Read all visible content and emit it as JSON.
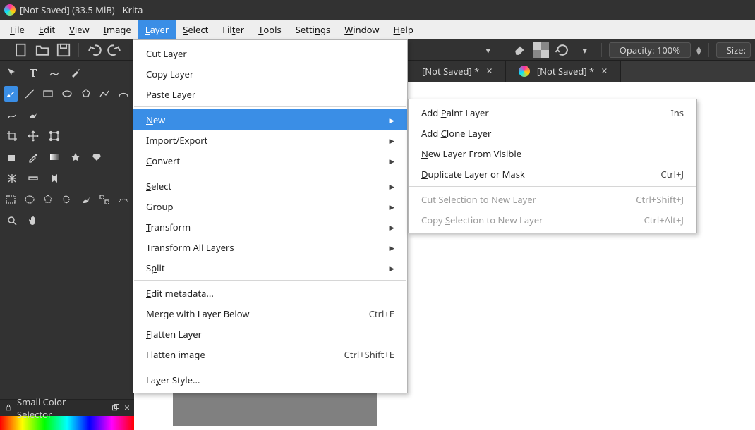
{
  "title": "[Not Saved]  (33.5 MiB)  - Krita",
  "menubar": {
    "items": [
      {
        "label": "File",
        "ul": "F"
      },
      {
        "label": "Edit",
        "ul": "E"
      },
      {
        "label": "View",
        "ul": "V"
      },
      {
        "label": "Image",
        "ul": "I"
      },
      {
        "label": "Layer",
        "ul": "L",
        "active": true
      },
      {
        "label": "Select",
        "ul": "S"
      },
      {
        "label": "Filter",
        "ul": "t"
      },
      {
        "label": "Tools",
        "ul": "T"
      },
      {
        "label": "Settings",
        "ul": "n"
      },
      {
        "label": "Window",
        "ul": "W"
      },
      {
        "label": "Help",
        "ul": "H"
      }
    ]
  },
  "options_toolbar": {
    "opacity_label": "Opacity: 100%",
    "size_label": "Size:"
  },
  "doc_tabs": [
    {
      "label": "[Not Saved]  *"
    },
    {
      "label": "[Not Saved]  *"
    }
  ],
  "panel": {
    "title": "Small Color Selector"
  },
  "layer_menu": {
    "items": [
      {
        "label": "Cut Layer"
      },
      {
        "label": "Copy Layer"
      },
      {
        "label": "Paste Layer"
      },
      {
        "sep": true
      },
      {
        "label": "New",
        "ul": "N",
        "submenu": true,
        "highlight": true
      },
      {
        "label": "Import/Export",
        "submenu": true
      },
      {
        "label": "Convert",
        "ul": "C",
        "submenu": true
      },
      {
        "sep": true
      },
      {
        "label": "Select",
        "ul": "S",
        "submenu": true
      },
      {
        "label": "Group",
        "ul": "G",
        "submenu": true
      },
      {
        "label": "Transform",
        "ul": "T",
        "submenu": true
      },
      {
        "label": "Transform All Layers",
        "ul": "A",
        "submenu": true
      },
      {
        "label": "Split",
        "ul": "p",
        "submenu": true
      },
      {
        "sep": true
      },
      {
        "label": "Edit metadata...",
        "ul": "E"
      },
      {
        "label": "Merge with Layer Below",
        "shortcut": "Ctrl+E"
      },
      {
        "label": "Flatten Layer",
        "ul": "F"
      },
      {
        "label": "Flatten image",
        "shortcut": "Ctrl+Shift+E"
      },
      {
        "sep": true
      },
      {
        "label": "Layer Style...",
        "ul": "y"
      }
    ]
  },
  "new_submenu": {
    "items": [
      {
        "label": "Add Paint Layer",
        "ul": "P",
        "shortcut": "Ins"
      },
      {
        "label": "Add Clone Layer",
        "ul": "C"
      },
      {
        "label": "New Layer From Visible",
        "ul": "N"
      },
      {
        "label": "Duplicate Layer or Mask",
        "ul": "D",
        "shortcut": "Ctrl+J"
      },
      {
        "sep": true
      },
      {
        "label": "Cut Selection to New Layer",
        "ul": "C",
        "shortcut": "Ctrl+Shift+J",
        "disabled": true
      },
      {
        "label": "Copy Selection to New Layer",
        "ul": "S",
        "shortcut": "Ctrl+Alt+J",
        "disabled": true
      }
    ]
  }
}
